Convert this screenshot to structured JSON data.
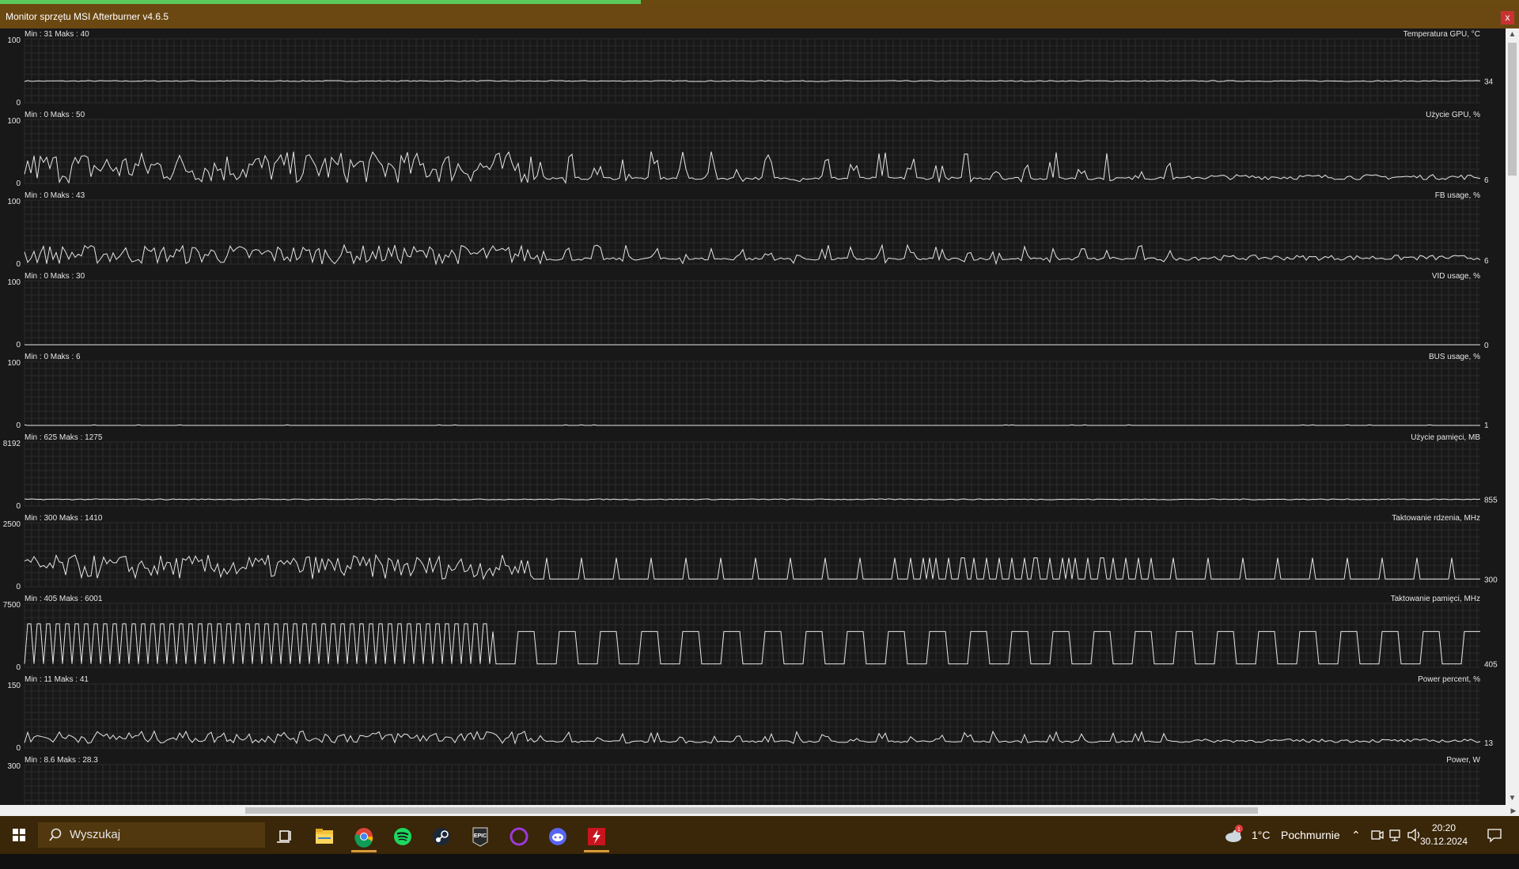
{
  "window": {
    "title": "Monitor sprzętu MSI Afterburner v4.6.5",
    "close_label": "x"
  },
  "graphs": [
    {
      "title": "Temperatura GPU, °C",
      "min_max": "Min : 31   Maks : 40",
      "scale_top": "100",
      "scale_bottom": "0",
      "current": "34",
      "min": 31,
      "max": 40,
      "current_value": 34,
      "scale_max": 100,
      "pattern": "flat"
    },
    {
      "title": "Użycie GPU, %",
      "min_max": "Min : 0   Maks : 50",
      "scale_top": "100",
      "scale_bottom": "0",
      "current": "6",
      "min": 0,
      "max": 50,
      "current_value": 6,
      "scale_max": 100,
      "pattern": "busy"
    },
    {
      "title": "FB usage, %",
      "min_max": "Min : 0   Maks : 43",
      "scale_top": "100",
      "scale_bottom": "0",
      "current": "6",
      "min": 0,
      "max": 43,
      "current_value": 6,
      "scale_max": 100,
      "pattern": "busy_low"
    },
    {
      "title": "VID usage, %",
      "min_max": "Min : 0   Maks : 30",
      "scale_top": "100",
      "scale_bottom": "0",
      "current": "0",
      "min": 0,
      "max": 30,
      "current_value": 0,
      "scale_max": 100,
      "pattern": "zero"
    },
    {
      "title": "BUS usage, %",
      "min_max": "Min : 0   Maks : 6",
      "scale_top": "100",
      "scale_bottom": "0",
      "current": "1",
      "min": 0,
      "max": 6,
      "current_value": 1,
      "scale_max": 100,
      "pattern": "near_zero"
    },
    {
      "title": "Użycie pamięci, MB",
      "min_max": "Min : 625   Maks : 1275",
      "scale_top": "8192",
      "scale_bottom": "0",
      "current": "855",
      "min": 625,
      "max": 1275,
      "current_value": 855,
      "scale_max": 8192,
      "pattern": "flat"
    },
    {
      "title": "Taktowanie rdzenia, MHz",
      "min_max": "Min : 300   Maks : 1410",
      "scale_top": "2500",
      "scale_bottom": "0",
      "current": "300",
      "min": 300,
      "max": 1410,
      "current_value": 300,
      "scale_max": 2500,
      "pattern": "spikes"
    },
    {
      "title": "Taktowanie pamięci, MHz",
      "min_max": "Min : 405   Maks : 6001",
      "scale_top": "7500",
      "scale_bottom": "0",
      "current": "405",
      "min": 405,
      "max": 6001,
      "current_value": 405,
      "scale_max": 7500,
      "pattern": "square"
    },
    {
      "title": "Power percent, %",
      "min_max": "Min : 11   Maks : 41",
      "scale_top": "150",
      "scale_bottom": "0",
      "current": "13",
      "min": 11,
      "max": 41,
      "current_value": 13,
      "scale_max": 150,
      "pattern": "busy_low"
    },
    {
      "title": "Power, W",
      "min_max": "Min : 8.6   Maks : 28.3",
      "scale_top": "300",
      "scale_bottom": "",
      "current": "",
      "min": 8.6,
      "max": 28.3,
      "scale_max": 300,
      "pattern": "none"
    }
  ],
  "taskbar": {
    "search_placeholder": "Wyszukaj",
    "weather_temp": "1°C",
    "weather_text": "Pochmurnie",
    "weather_badge": "1",
    "time": "20:20",
    "date": "30.12.2024",
    "epic_label": "EPIC",
    "accent_color": "#d99b3a",
    "apps": [
      "start-icon",
      "task-view-icon",
      "file-explorer-icon",
      "chrome-icon",
      "spotify-icon",
      "steam-icon",
      "epic-games-icon",
      "circle-app-icon",
      "discord-icon",
      "msi-afterburner-icon"
    ]
  },
  "colors": {
    "titlebar": "#6b4812",
    "graph_bg": "#181818",
    "grid": "#2c2c2c",
    "trace": "#e6e6e6",
    "taskbar": "#3a2608"
  }
}
